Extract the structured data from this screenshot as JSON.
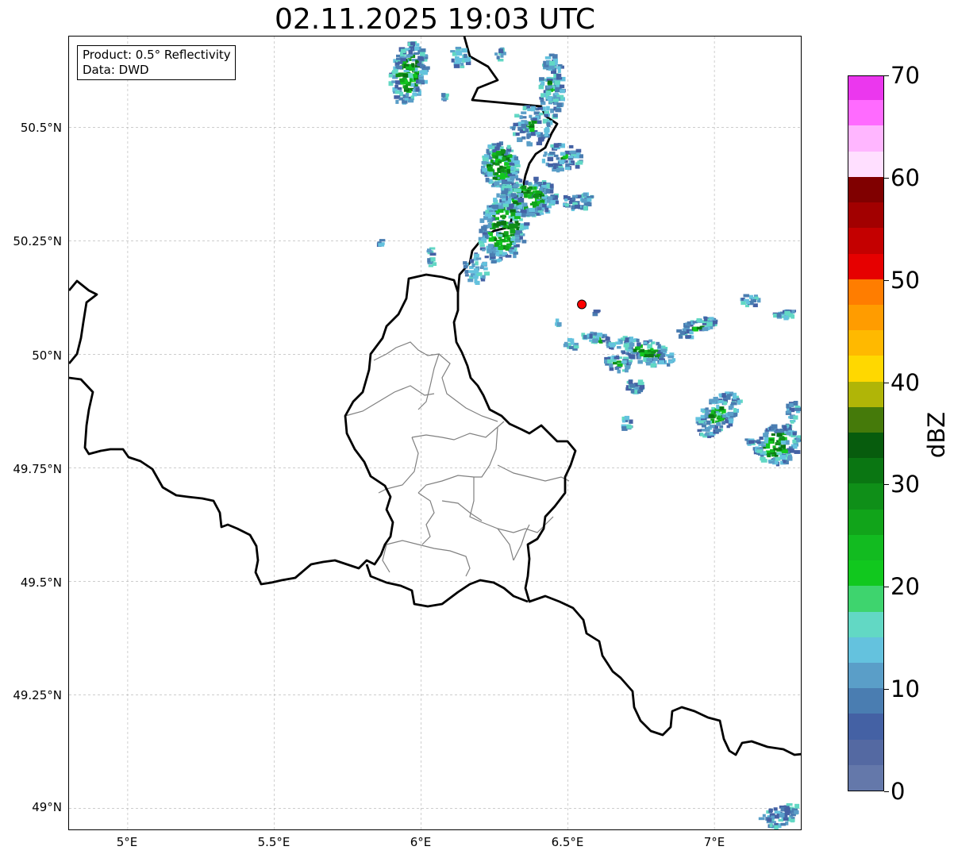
{
  "title": "02.11.2025 19:03 UTC",
  "info_box": {
    "product_line": "Product: 0.5° Reflectivity",
    "data_line": "Data: DWD"
  },
  "map": {
    "lon_range": [
      4.8,
      7.3
    ],
    "lat_range": [
      48.95,
      50.7
    ],
    "x_ticks": [
      "5°E",
      "5.5°E",
      "6°E",
      "6.5°E",
      "7°E"
    ],
    "y_ticks": [
      "50.5°N",
      "50.25°N",
      "50°N",
      "49.75°N",
      "49.5°N",
      "49.25°N",
      "49°N"
    ],
    "grid": "dashed",
    "radar_site_marker": {
      "lon": 6.548,
      "lat": 50.11,
      "color": "#ff0000"
    }
  },
  "colorbar": {
    "label": "dBZ",
    "min": 0,
    "max": 70,
    "tick_labels": [
      "0",
      "10",
      "20",
      "30",
      "40",
      "50",
      "60",
      "70"
    ],
    "colors": [
      "#6478aa",
      "#5469a2",
      "#4461a4",
      "#4a7db1",
      "#5a9ec8",
      "#64c2de",
      "#62d8c4",
      "#3ed46e",
      "#11c81e",
      "#12bb20",
      "#11a41a",
      "#0f8f18",
      "#0a7612",
      "#075c0d",
      "#457a0a",
      "#b0b507",
      "#ffd800",
      "#ffb900",
      "#ff9c00",
      "#ff7d00",
      "#e60000",
      "#c40000",
      "#a20000",
      "#800000",
      "#ffdfff",
      "#ffb6ff",
      "#ff6bff",
      "#eb37ee"
    ]
  }
}
